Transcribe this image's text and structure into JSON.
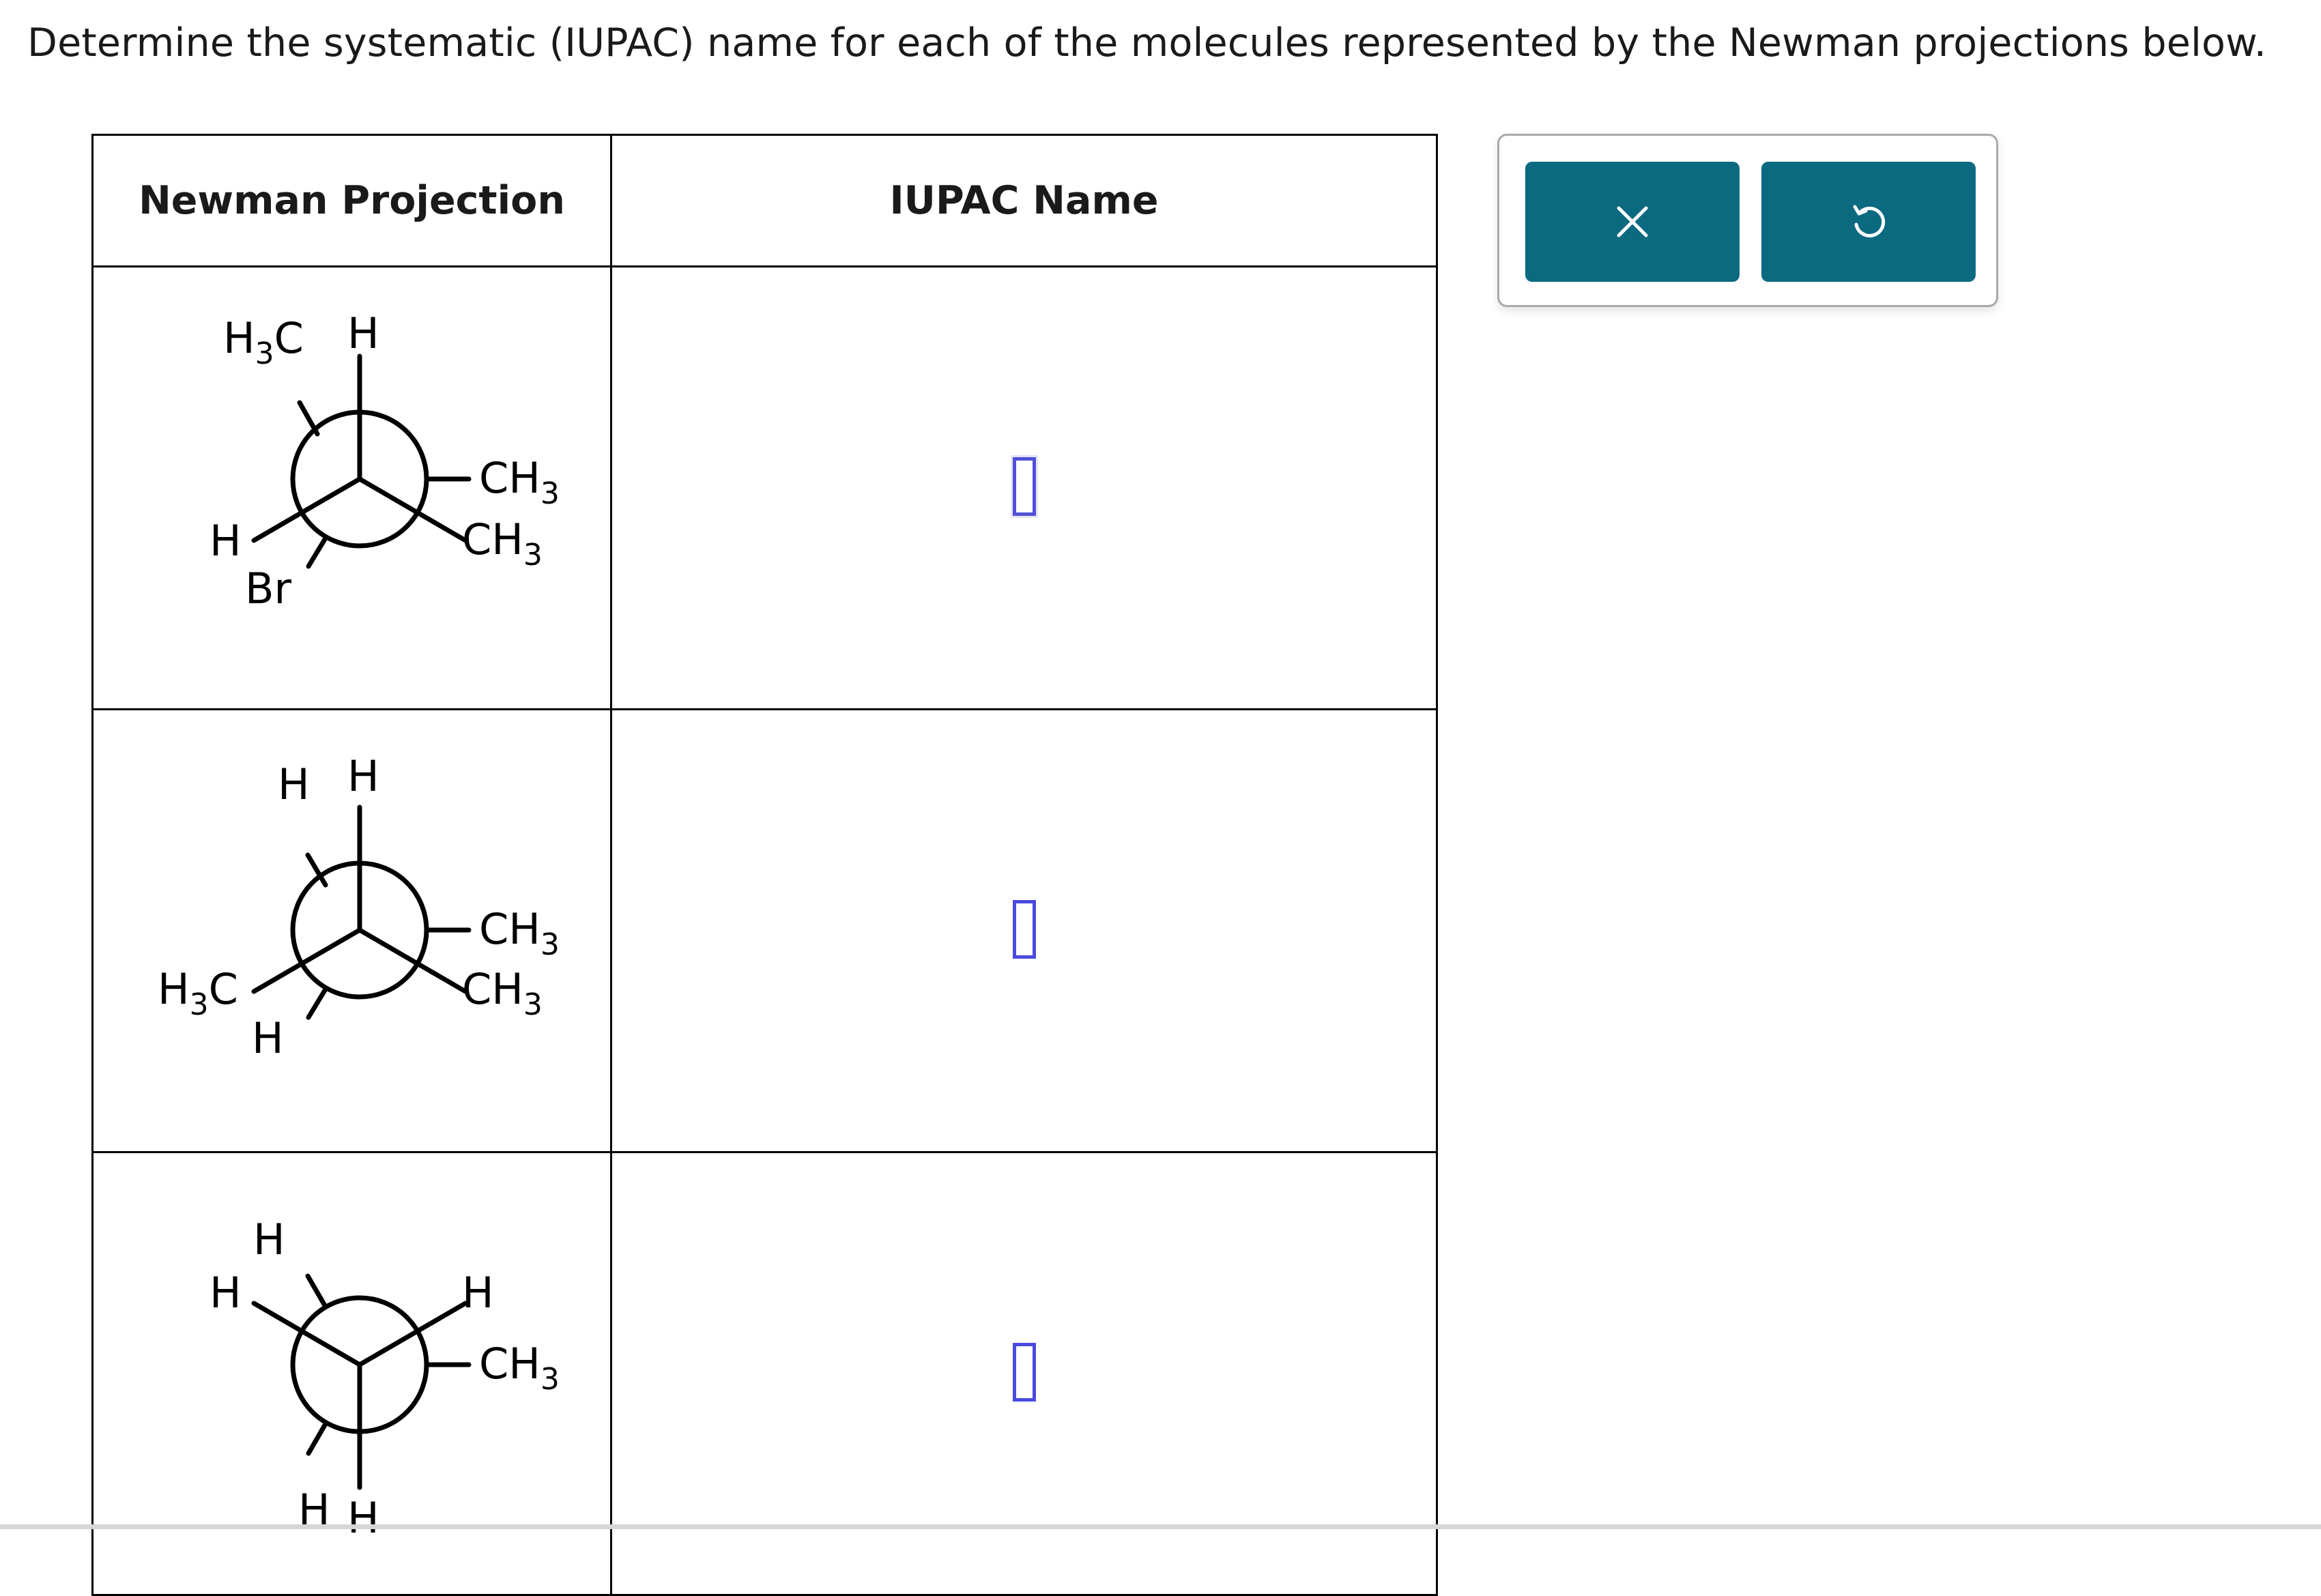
{
  "prompt": "Determine the systematic (IUPAC) name for each of the molecules represented by the Newman projections below.",
  "table": {
    "headers": [
      "Newman Projection",
      "IUPAC Name"
    ],
    "rows": [
      {
        "front": {
          "top": "H",
          "lower_left": "H",
          "lower_right": "CH3"
        },
        "back": {
          "upper_left": "H3C",
          "upper_right": "CH3",
          "bottom": "Br"
        },
        "answer": ""
      },
      {
        "front": {
          "top": "H",
          "lower_left": "H3C",
          "lower_right": "CH3"
        },
        "back": {
          "upper_left": "H",
          "upper_right": "CH3",
          "bottom": "H"
        },
        "answer": ""
      },
      {
        "front": {
          "bottom": "H",
          "upper_left": "H",
          "upper_right": "CH3"
        },
        "back": {
          "top": "H",
          "lower_left": "H",
          "lower_right": "H"
        },
        "answer": ""
      }
    ]
  },
  "toolbar": {
    "clear": "clear-x-icon",
    "reset": "reset-undo-icon"
  },
  "colors": {
    "button": "#0b6a80",
    "input_border": "#4a4ae0",
    "grid": "#000000"
  }
}
